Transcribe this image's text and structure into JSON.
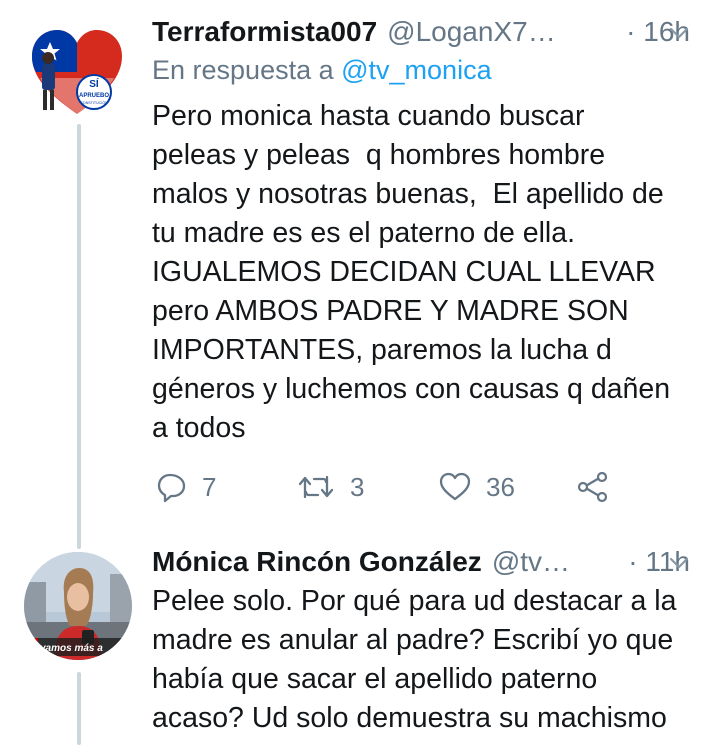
{
  "tweets": [
    {
      "display_name": "Terraformista007",
      "handle": "@LoganX7…",
      "time": "· 16h",
      "reply_prefix": "En respuesta a ",
      "reply_handle": "@tv_monica",
      "text": "Pero monica hasta cuando buscar\npeleas y peleas  q hombres hombre\nmalos y nosotras buenas,  El apellido de\ntu madre es es el paterno de ella.\nIGUALEMOS DECIDAN CUAL LLEVAR\npero AMBOS PADRE Y MADRE SON\nIMPORTANTES, paremos la lucha d\ngéneros y luchemos con causas q dañen\na todos",
      "avatar_text": "SÍ APRUEBO NUEVA CONSTITUCIÓN",
      "actions": {
        "replies": "7",
        "retweets": "3",
        "likes": "36"
      }
    },
    {
      "display_name": "Mónica Rincón González",
      "handle": "@tv…",
      "time": "· 11h",
      "text": "Pelee solo. Por qué para ud destacar a la\nmadre es anular al padre? Escribí yo que\nhabía que sacar el apellido paterno\nacaso? Ud solo demuestra su machismo",
      "avatar_text": "vamos más a"
    }
  ],
  "icons": {
    "reply": "reply-icon",
    "retweet": "retweet-icon",
    "like": "heart-icon",
    "share": "share-icon",
    "more": "chevron-down-icon"
  },
  "colors": {
    "text": "#14171a",
    "secondary": "#657786",
    "link": "#1da1f2",
    "thread_line": "#ccd6dd",
    "flag_red": "#d52b1e",
    "flag_blue": "#0039a6"
  }
}
